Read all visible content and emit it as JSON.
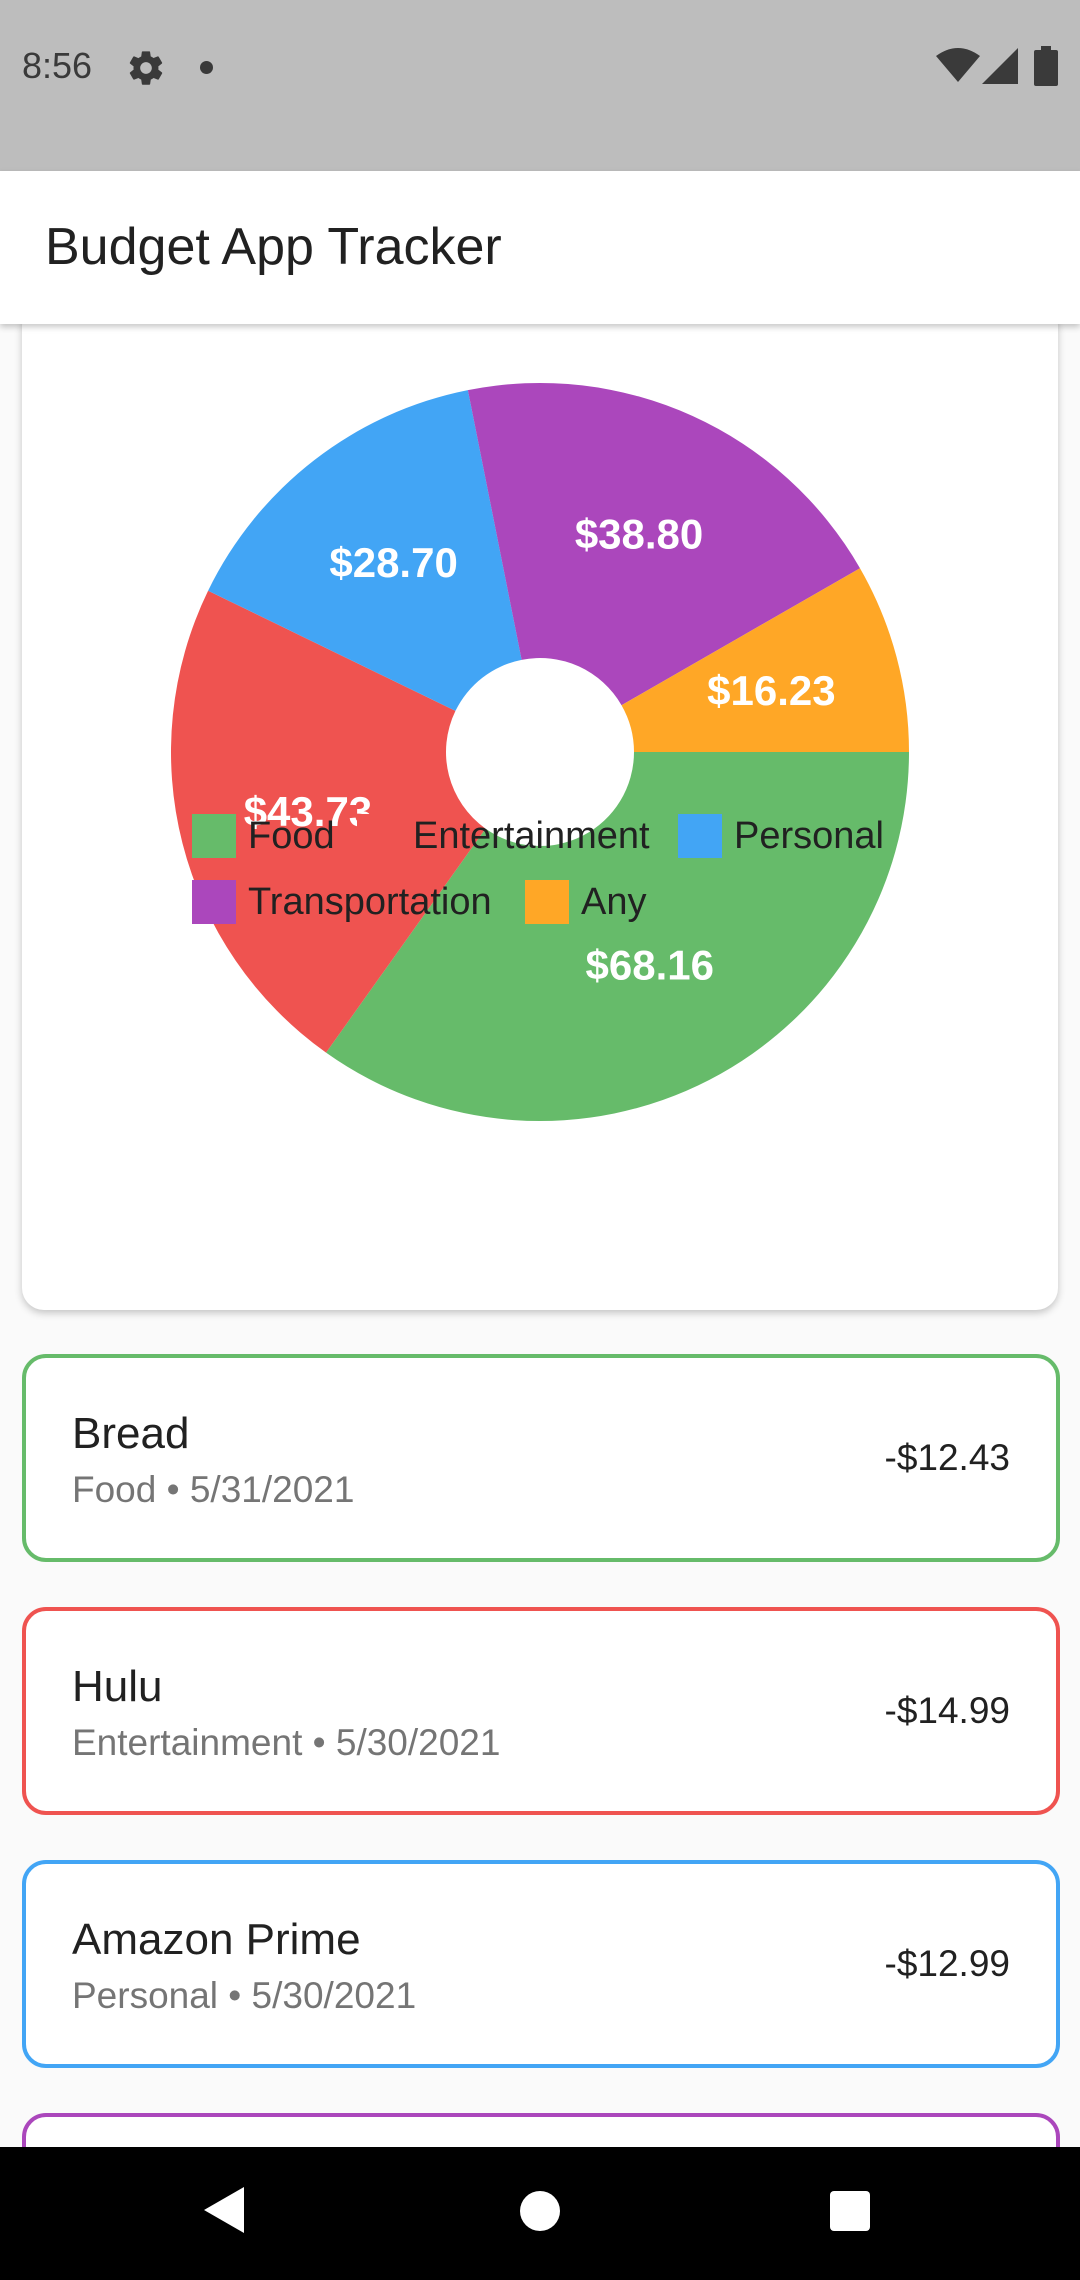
{
  "status_bar": {
    "time": "8:56",
    "icons": [
      "gear-icon",
      "notification-dot-icon",
      "wifi-icon",
      "signal-icon",
      "battery-icon"
    ]
  },
  "app_bar": {
    "title": "Budget App Tracker"
  },
  "colors": {
    "food": "#66bb6a",
    "entertainment": "#ef5350",
    "personal": "#42a5f5",
    "transportation": "#ab47bc",
    "any": "#ffa726"
  },
  "chart_data": {
    "type": "pie",
    "donut": true,
    "slices": [
      {
        "label": "$68.16",
        "value": 68.16,
        "category": "Food",
        "color": "#66bb6a"
      },
      {
        "label": "$43.73",
        "value": 43.73,
        "category": "Entertainment",
        "color": "#ef5350"
      },
      {
        "label": "$28.70",
        "value": 28.7,
        "category": "Personal",
        "color": "#42a5f5"
      },
      {
        "label": "$38.80",
        "value": 38.8,
        "category": "Transportation",
        "color": "#ab47bc"
      },
      {
        "label": "$16.23",
        "value": 16.23,
        "category": "Any",
        "color": "#ffa726"
      }
    ],
    "legend": [
      {
        "label": "Food",
        "color": "#66bb6a"
      },
      {
        "label": "Entertainment",
        "color": "#ef5350"
      },
      {
        "label": "Personal",
        "color": "#42a5f5"
      },
      {
        "label": "Transportation",
        "color": "#ab47bc"
      },
      {
        "label": "Any",
        "color": "#ffa726"
      }
    ],
    "legend_position": "bottom"
  },
  "transactions": [
    {
      "name": "Bread",
      "subtitle": "Food • 5/31/2021",
      "amount": "-$12.43",
      "color": "#66bb6a"
    },
    {
      "name": "Hulu",
      "subtitle": "Entertainment • 5/30/2021",
      "amount": "-$14.99",
      "color": "#ef5350"
    },
    {
      "name": "Amazon Prime",
      "subtitle": "Personal • 5/30/2021",
      "amount": "-$12.99",
      "color": "#42a5f5"
    },
    {
      "name": "",
      "subtitle": "",
      "amount": "",
      "color": "#ab47bc"
    }
  ],
  "nav_bar": {
    "icons": [
      "back-icon",
      "home-icon",
      "recents-icon"
    ]
  }
}
